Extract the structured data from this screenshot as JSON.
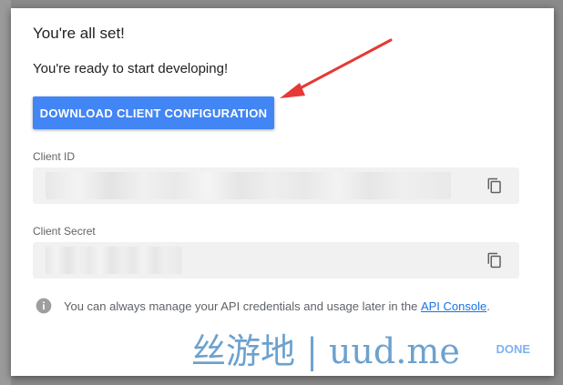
{
  "dialog": {
    "title": "You're all set!",
    "subtitle": "You're ready to start developing!",
    "download_button": "DOWNLOAD CLIENT CONFIGURATION",
    "client_id_label": "Client ID",
    "client_secret_label": "Client Secret",
    "info_text": "You can always manage your API credentials and usage later in the ",
    "api_link": "API Console",
    "info_suffix": ".",
    "done_button": "DONE"
  },
  "watermark": "丝游地 | uud.me",
  "colors": {
    "primary_button": "#4285f4",
    "link": "#1a73e8",
    "field_bg": "#f1f1f1",
    "annotation_arrow": "#e53935"
  },
  "icons": {
    "copy": "copy-icon",
    "info": "info-icon",
    "annotation": "red-arrow-icon"
  }
}
